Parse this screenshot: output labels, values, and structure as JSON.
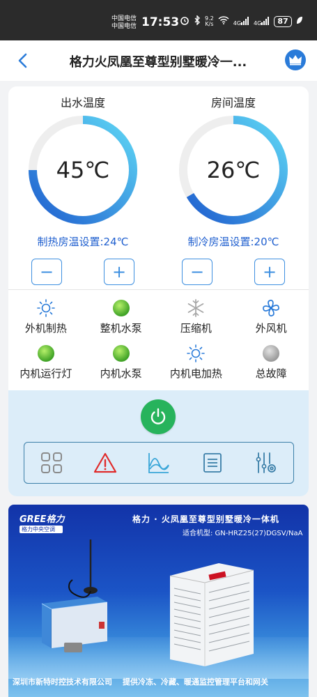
{
  "status_bar": {
    "carrier_1": "中国电信",
    "carrier_2": "中国电信",
    "time": "17:53",
    "net_speed": "9.2",
    "net_speed_unit": "K/s",
    "signal_1": "4G",
    "signal_2": "4G",
    "battery": "87"
  },
  "header": {
    "title": "格力火凤凰至尊型别墅暖冷一..."
  },
  "gauges": {
    "outlet": {
      "title": "出水温度",
      "value": "45℃",
      "setpoint": "制热房温设置:24℃"
    },
    "room": {
      "title": "房间温度",
      "value": "26℃",
      "setpoint": "制冷房温设置:20℃"
    }
  },
  "stepper": {
    "minus": "−",
    "plus": "+"
  },
  "status_items": [
    {
      "label": "外机制热",
      "icon": "sun-icon"
    },
    {
      "label": "整机水泵",
      "icon": "green-led"
    },
    {
      "label": "压缩机",
      "icon": "snowflake-icon"
    },
    {
      "label": "外风机",
      "icon": "fan-icon"
    },
    {
      "label": "内机运行灯",
      "icon": "green-led"
    },
    {
      "label": "内机水泵",
      "icon": "green-led"
    },
    {
      "label": "内机电加热",
      "icon": "sun-icon"
    },
    {
      "label": "总故障",
      "icon": "gray-led"
    }
  ],
  "colors": {
    "accent": "#2a7bd9",
    "gauge_start": "#1f5fcf",
    "gauge_end": "#5fd8f5",
    "power": "#27b35c",
    "panel_bg": "#dcedf9"
  },
  "banner": {
    "logo_brand": "GREE格力",
    "logo_sub": "格力中央空调",
    "title": "格力 · 火凤凰至尊型别墅暖冷一体机",
    "model": "适合机型:  GN-HRZ25(27)DGSV/NaA",
    "footer_left": "深圳市新特时控技术有限公司",
    "footer_right": "提供冷冻、冷藏、暖通监控管理平台和网关"
  }
}
